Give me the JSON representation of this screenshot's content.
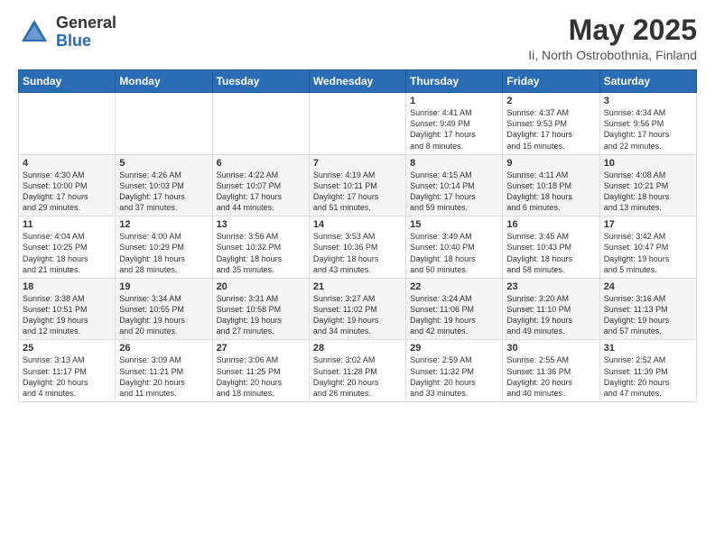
{
  "header": {
    "logo_general": "General",
    "logo_blue": "Blue",
    "title": "May 2025",
    "subtitle": "Ii, North Ostrobothnia, Finland"
  },
  "days_of_week": [
    "Sunday",
    "Monday",
    "Tuesday",
    "Wednesday",
    "Thursday",
    "Friday",
    "Saturday"
  ],
  "weeks": [
    [
      {
        "num": "",
        "info": ""
      },
      {
        "num": "",
        "info": ""
      },
      {
        "num": "",
        "info": ""
      },
      {
        "num": "",
        "info": ""
      },
      {
        "num": "1",
        "info": "Sunrise: 4:41 AM\nSunset: 9:49 PM\nDaylight: 17 hours\nand 8 minutes."
      },
      {
        "num": "2",
        "info": "Sunrise: 4:37 AM\nSunset: 9:53 PM\nDaylight: 17 hours\nand 15 minutes."
      },
      {
        "num": "3",
        "info": "Sunrise: 4:34 AM\nSunset: 9:56 PM\nDaylight: 17 hours\nand 22 minutes."
      }
    ],
    [
      {
        "num": "4",
        "info": "Sunrise: 4:30 AM\nSunset: 10:00 PM\nDaylight: 17 hours\nand 29 minutes."
      },
      {
        "num": "5",
        "info": "Sunrise: 4:26 AM\nSunset: 10:03 PM\nDaylight: 17 hours\nand 37 minutes."
      },
      {
        "num": "6",
        "info": "Sunrise: 4:22 AM\nSunset: 10:07 PM\nDaylight: 17 hours\nand 44 minutes."
      },
      {
        "num": "7",
        "info": "Sunrise: 4:19 AM\nSunset: 10:11 PM\nDaylight: 17 hours\nand 51 minutes."
      },
      {
        "num": "8",
        "info": "Sunrise: 4:15 AM\nSunset: 10:14 PM\nDaylight: 17 hours\nand 59 minutes."
      },
      {
        "num": "9",
        "info": "Sunrise: 4:11 AM\nSunset: 10:18 PM\nDaylight: 18 hours\nand 6 minutes."
      },
      {
        "num": "10",
        "info": "Sunrise: 4:08 AM\nSunset: 10:21 PM\nDaylight: 18 hours\nand 13 minutes."
      }
    ],
    [
      {
        "num": "11",
        "info": "Sunrise: 4:04 AM\nSunset: 10:25 PM\nDaylight: 18 hours\nand 21 minutes."
      },
      {
        "num": "12",
        "info": "Sunrise: 4:00 AM\nSunset: 10:29 PM\nDaylight: 18 hours\nand 28 minutes."
      },
      {
        "num": "13",
        "info": "Sunrise: 3:56 AM\nSunset: 10:32 PM\nDaylight: 18 hours\nand 35 minutes."
      },
      {
        "num": "14",
        "info": "Sunrise: 3:53 AM\nSunset: 10:36 PM\nDaylight: 18 hours\nand 43 minutes."
      },
      {
        "num": "15",
        "info": "Sunrise: 3:49 AM\nSunset: 10:40 PM\nDaylight: 18 hours\nand 50 minutes."
      },
      {
        "num": "16",
        "info": "Sunrise: 3:45 AM\nSunset: 10:43 PM\nDaylight: 18 hours\nand 58 minutes."
      },
      {
        "num": "17",
        "info": "Sunrise: 3:42 AM\nSunset: 10:47 PM\nDaylight: 19 hours\nand 5 minutes."
      }
    ],
    [
      {
        "num": "18",
        "info": "Sunrise: 3:38 AM\nSunset: 10:51 PM\nDaylight: 19 hours\nand 12 minutes."
      },
      {
        "num": "19",
        "info": "Sunrise: 3:34 AM\nSunset: 10:55 PM\nDaylight: 19 hours\nand 20 minutes."
      },
      {
        "num": "20",
        "info": "Sunrise: 3:31 AM\nSunset: 10:58 PM\nDaylight: 19 hours\nand 27 minutes."
      },
      {
        "num": "21",
        "info": "Sunrise: 3:27 AM\nSunset: 11:02 PM\nDaylight: 19 hours\nand 34 minutes."
      },
      {
        "num": "22",
        "info": "Sunrise: 3:24 AM\nSunset: 11:06 PM\nDaylight: 19 hours\nand 42 minutes."
      },
      {
        "num": "23",
        "info": "Sunrise: 3:20 AM\nSunset: 11:10 PM\nDaylight: 19 hours\nand 49 minutes."
      },
      {
        "num": "24",
        "info": "Sunrise: 3:16 AM\nSunset: 11:13 PM\nDaylight: 19 hours\nand 57 minutes."
      }
    ],
    [
      {
        "num": "25",
        "info": "Sunrise: 3:13 AM\nSunset: 11:17 PM\nDaylight: 20 hours\nand 4 minutes."
      },
      {
        "num": "26",
        "info": "Sunrise: 3:09 AM\nSunset: 11:21 PM\nDaylight: 20 hours\nand 11 minutes."
      },
      {
        "num": "27",
        "info": "Sunrise: 3:06 AM\nSunset: 11:25 PM\nDaylight: 20 hours\nand 18 minutes."
      },
      {
        "num": "28",
        "info": "Sunrise: 3:02 AM\nSunset: 11:28 PM\nDaylight: 20 hours\nand 26 minutes."
      },
      {
        "num": "29",
        "info": "Sunrise: 2:59 AM\nSunset: 11:32 PM\nDaylight: 20 hours\nand 33 minutes."
      },
      {
        "num": "30",
        "info": "Sunrise: 2:55 AM\nSunset: 11:36 PM\nDaylight: 20 hours\nand 40 minutes."
      },
      {
        "num": "31",
        "info": "Sunrise: 2:52 AM\nSunset: 11:39 PM\nDaylight: 20 hours\nand 47 minutes."
      }
    ]
  ]
}
